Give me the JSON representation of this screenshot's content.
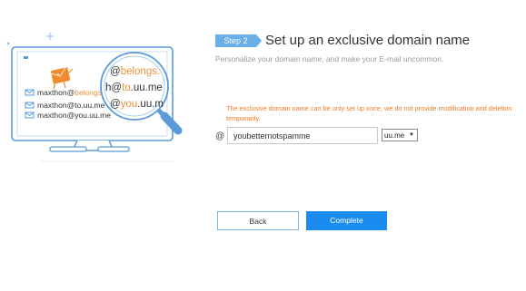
{
  "illustration": {
    "emails": [
      {
        "user": "maxthon@",
        "domain": "belongs"
      },
      {
        "user": "maxthon@",
        "domain": "to.uu.me"
      },
      {
        "user": "maxthon@",
        "domain": "you.uu.me"
      }
    ],
    "magnified": [
      {
        "prefix": "@",
        "highlight": "belongs.",
        "rest": ""
      },
      {
        "prefix": "h@",
        "highlight": "to",
        "rest": ".uu.me"
      },
      {
        "prefix": "@",
        "highlight": "you",
        "rest": ".uu.m"
      }
    ],
    "colors": {
      "accent": "#f29136",
      "line": "#5b9ad8"
    }
  },
  "step": {
    "badge": "Step 2",
    "title": "Set up an exclusive domain name"
  },
  "subtitle": "Personalize your domain name, and make your E-mail uncommon.",
  "warning": "The exclusive domain name can be only set up once, we do not provide modification and deletion temporarily.",
  "form": {
    "at_symbol": "@",
    "domain_value": "youbetternotspamme",
    "suffix_selected": "uu.me"
  },
  "buttons": {
    "back": "Back",
    "complete": "Complete"
  }
}
